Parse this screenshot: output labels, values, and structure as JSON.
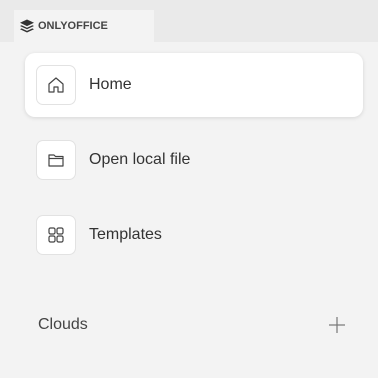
{
  "tabbar": {
    "home_tab_label": "ONLYOFFICE"
  },
  "nav": {
    "items": [
      {
        "label": "Home",
        "icon": "home-icon",
        "active": true
      },
      {
        "label": "Open local file",
        "icon": "folder-icon",
        "active": false
      },
      {
        "label": "Templates",
        "icon": "templates-grid-icon",
        "active": false
      }
    ],
    "clouds_label": "Clouds",
    "add_cloud_icon": "plus-icon"
  },
  "colors": {
    "background": "#f3f3f3",
    "tabbar": "#eaeaea",
    "active_item": "#ffffff",
    "text": "#333333"
  }
}
